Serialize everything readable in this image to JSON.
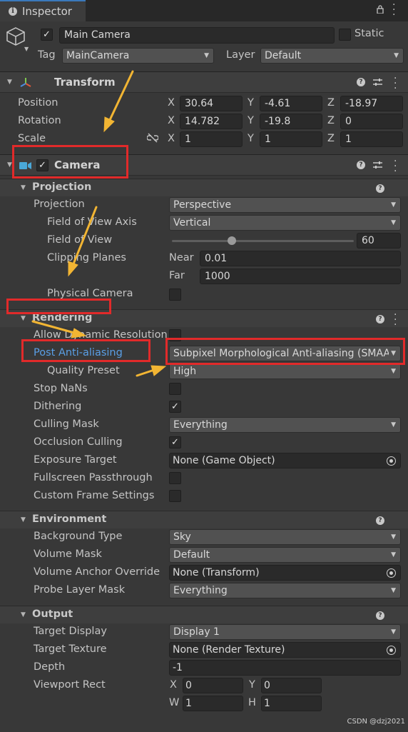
{
  "tab": {
    "title": "Inspector",
    "lock_icon": "lock-icon",
    "menu_icon": "kebab-menu-icon"
  },
  "header": {
    "object_name": "Main Camera",
    "active_checked": true,
    "static_label": "Static",
    "tag_label": "Tag",
    "tag_value": "MainCamera",
    "layer_label": "Layer",
    "layer_value": "Default"
  },
  "transform": {
    "title": "Transform",
    "position_label": "Position",
    "rotation_label": "Rotation",
    "scale_label": "Scale",
    "axis_x": "X",
    "axis_y": "Y",
    "axis_z": "Z",
    "position": {
      "x": "30.64",
      "y": "-4.61",
      "z": "-18.97"
    },
    "rotation": {
      "x": "14.782",
      "y": "-19.8",
      "z": "0"
    },
    "scale": {
      "x": "1",
      "y": "1",
      "z": "1"
    }
  },
  "camera": {
    "title": "Camera",
    "enabled": true,
    "projection": {
      "section_title": "Projection",
      "projection_label": "Projection",
      "projection_value": "Perspective",
      "fov_axis_label": "Field of View Axis",
      "fov_axis_value": "Vertical",
      "fov_label": "Field of View",
      "fov_value": "60",
      "clipping_label": "Clipping Planes",
      "near_label": "Near",
      "near_value": "0.01",
      "far_label": "Far",
      "far_value": "1000",
      "physical_label": "Physical Camera"
    },
    "rendering": {
      "section_title": "Rendering",
      "dynamic_res_label": "Allow Dynamic Resolution",
      "post_aa_label": "Post Anti-aliasing",
      "post_aa_value": "Subpixel Morphological Anti-aliasing (SMAA)",
      "quality_label": "Quality Preset",
      "quality_value": "High",
      "stop_nans_label": "Stop NaNs",
      "dithering_label": "Dithering",
      "culling_label": "Culling Mask",
      "culling_value": "Everything",
      "occlusion_label": "Occlusion Culling",
      "exposure_label": "Exposure Target",
      "exposure_value": "None (Game Object)",
      "fullscreen_label": "Fullscreen Passthrough",
      "custom_frame_label": "Custom Frame Settings"
    },
    "environment": {
      "section_title": "Environment",
      "bg_type_label": "Background Type",
      "bg_type_value": "Sky",
      "volume_mask_label": "Volume Mask",
      "volume_mask_value": "Default",
      "volume_anchor_label": "Volume Anchor Override",
      "volume_anchor_value": "None (Transform)",
      "probe_layer_label": "Probe Layer Mask",
      "probe_layer_value": "Everything"
    },
    "output": {
      "section_title": "Output",
      "target_display_label": "Target Display",
      "target_display_value": "Display 1",
      "target_texture_label": "Target Texture",
      "target_texture_value": "None (Render Texture)",
      "depth_label": "Depth",
      "depth_value": "-1",
      "viewport_label": "Viewport Rect",
      "vp_x_label": "X",
      "vp_y_label": "Y",
      "vp_w_label": "W",
      "vp_h_label": "H",
      "vp_x": "0",
      "vp_y": "0",
      "vp_w": "1",
      "vp_h": "1"
    }
  },
  "footer": {
    "watermark": "CSDN @dzj2021"
  },
  "colors": {
    "background": "#383838",
    "accent_blue": "#5a9fe6",
    "annotation_red": "#e12a2a",
    "annotation_arrow": "#f2b533"
  }
}
